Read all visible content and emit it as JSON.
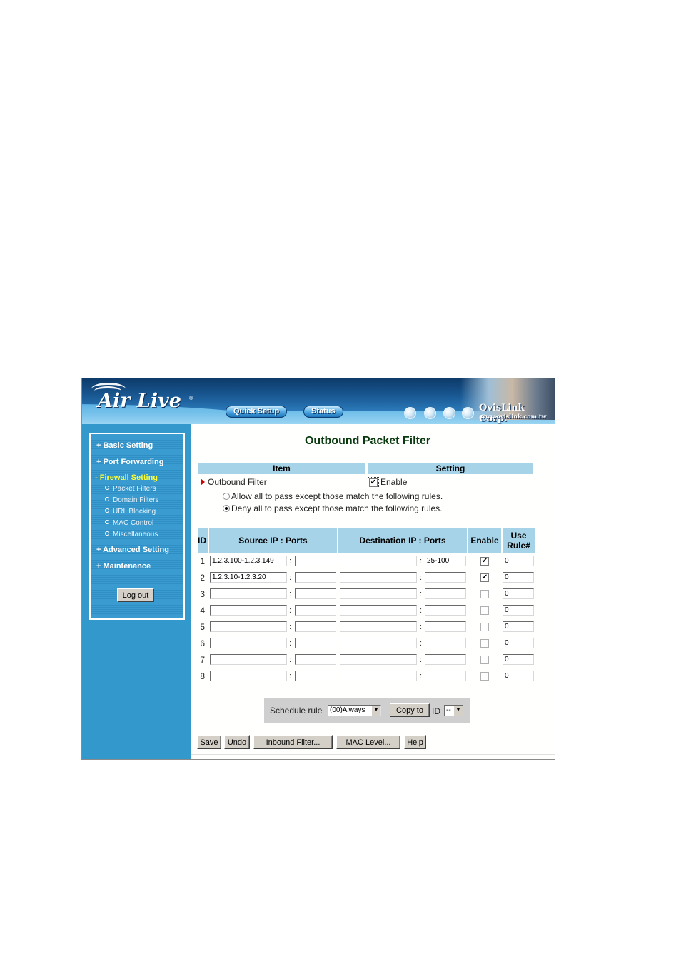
{
  "header": {
    "logo_text": "Air Live",
    "logo_mark": "®",
    "nav": [
      {
        "label": "Quick Setup"
      },
      {
        "label": "Status"
      }
    ],
    "globe_icons": [
      "globe-icon",
      "globe-icon",
      "globe-icon",
      "globe-icon"
    ],
    "corp_name": "OvisLink Corp.",
    "corp_url": "www.ovislink.com.tw"
  },
  "sidebar": {
    "menu": [
      {
        "label": "+ Basic Setting",
        "active": false
      },
      {
        "label": "+ Port Forwarding",
        "active": false
      },
      {
        "label": "- Firewall Setting",
        "active": true
      },
      {
        "label": "+ Advanced Setting",
        "active": false
      },
      {
        "label": "+ Maintenance",
        "active": false
      }
    ],
    "submenu": [
      {
        "label": "Packet Filters"
      },
      {
        "label": "Domain Filters"
      },
      {
        "label": "URL Blocking"
      },
      {
        "label": "MAC Control"
      },
      {
        "label": "Miscellaneous"
      }
    ],
    "logout_label": "Log out"
  },
  "main": {
    "title": "Outbound Packet Filter",
    "item_header": "Item",
    "setting_header": "Setting",
    "outbound_filter_label": "Outbound Filter",
    "enable_label": "Enable",
    "enable_checked": true,
    "mode_options": [
      {
        "label": "Allow all to pass except those match the following rules.",
        "selected": false
      },
      {
        "label": "Deny all to pass except those match the following rules.",
        "selected": true
      }
    ],
    "table": {
      "columns": [
        "ID",
        "Source IP : Ports",
        "Destination IP : Ports",
        "Enable",
        "Use Rule#"
      ],
      "col_use_line1": "Use",
      "col_use_line2": "Rule#",
      "separator": ":",
      "rows": [
        {
          "id": "1",
          "src_ip": "1.2.3.100-1.2.3.149",
          "src_port": "",
          "dst_ip": "",
          "dst_port": "25-100",
          "enabled": true,
          "rule": "0"
        },
        {
          "id": "2",
          "src_ip": "1.2.3.10-1.2.3.20",
          "src_port": "",
          "dst_ip": "",
          "dst_port": "",
          "enabled": true,
          "rule": "0"
        },
        {
          "id": "3",
          "src_ip": "",
          "src_port": "",
          "dst_ip": "",
          "dst_port": "",
          "enabled": false,
          "rule": "0"
        },
        {
          "id": "4",
          "src_ip": "",
          "src_port": "",
          "dst_ip": "",
          "dst_port": "",
          "enabled": false,
          "rule": "0"
        },
        {
          "id": "5",
          "src_ip": "",
          "src_port": "",
          "dst_ip": "",
          "dst_port": "",
          "enabled": false,
          "rule": "0"
        },
        {
          "id": "6",
          "src_ip": "",
          "src_port": "",
          "dst_ip": "",
          "dst_port": "",
          "enabled": false,
          "rule": "0"
        },
        {
          "id": "7",
          "src_ip": "",
          "src_port": "",
          "dst_ip": "",
          "dst_port": "",
          "enabled": false,
          "rule": "0"
        },
        {
          "id": "8",
          "src_ip": "",
          "src_port": "",
          "dst_ip": "",
          "dst_port": "",
          "enabled": false,
          "rule": "0"
        }
      ]
    },
    "schedule": {
      "label": "Schedule rule",
      "selected": "(00)Always",
      "copy_label": "Copy to",
      "id_label": "ID",
      "id_selected": "--"
    },
    "buttons": {
      "save": "Save",
      "undo": "Undo",
      "inbound": "Inbound Filter...",
      "mac": "MAC Level...",
      "help": "Help"
    }
  }
}
